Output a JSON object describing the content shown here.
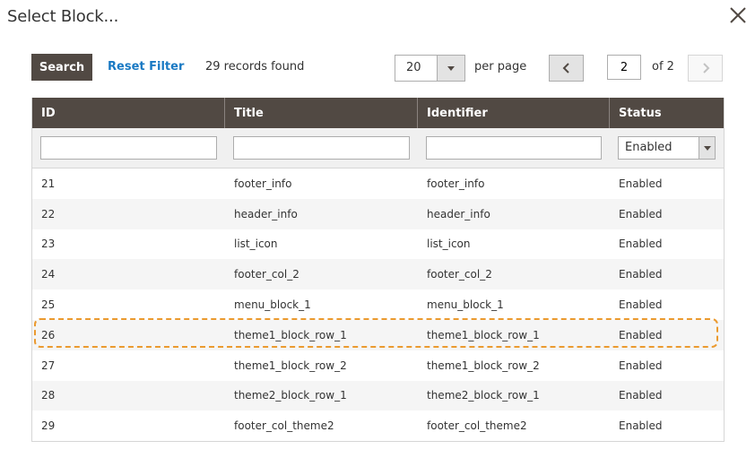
{
  "modal": {
    "title": "Select Block..."
  },
  "toolbar": {
    "search_label": "Search",
    "reset_filter_label": "Reset Filter",
    "records_found": "29 records found",
    "per_page_value": "20",
    "per_page_label": "per page",
    "current_page": "2",
    "page_of": "of 2"
  },
  "grid": {
    "columns": [
      "ID",
      "Title",
      "Identifier",
      "Status"
    ],
    "filters": {
      "id": "",
      "title": "",
      "identifier": "",
      "status": "Enabled"
    },
    "rows": [
      {
        "id": "21",
        "title": "footer_info",
        "identifier": "footer_info",
        "status": "Enabled"
      },
      {
        "id": "22",
        "title": "header_info",
        "identifier": "header_info",
        "status": "Enabled"
      },
      {
        "id": "23",
        "title": "list_icon",
        "identifier": "list_icon",
        "status": "Enabled"
      },
      {
        "id": "24",
        "title": "footer_col_2",
        "identifier": "footer_col_2",
        "status": "Enabled"
      },
      {
        "id": "25",
        "title": "menu_block_1",
        "identifier": "menu_block_1",
        "status": "Enabled"
      },
      {
        "id": "26",
        "title": "theme1_block_row_1",
        "identifier": "theme1_block_row_1",
        "status": "Enabled"
      },
      {
        "id": "27",
        "title": "theme1_block_row_2",
        "identifier": "theme1_block_row_2",
        "status": "Enabled"
      },
      {
        "id": "28",
        "title": "theme2_block_row_1",
        "identifier": "theme2_block_row_1",
        "status": "Enabled"
      },
      {
        "id": "29",
        "title": "footer_col_theme2",
        "identifier": "footer_col_theme2",
        "status": "Enabled"
      }
    ],
    "highlighted_row_index": 5
  },
  "colors": {
    "header_bg": "#514943",
    "link": "#1979c3",
    "highlight_border": "#eb9a2f"
  },
  "icons": {
    "close": "close-icon",
    "prev": "chevron-left-icon",
    "next": "chevron-right-icon",
    "dropdown": "triangle-down-icon"
  }
}
